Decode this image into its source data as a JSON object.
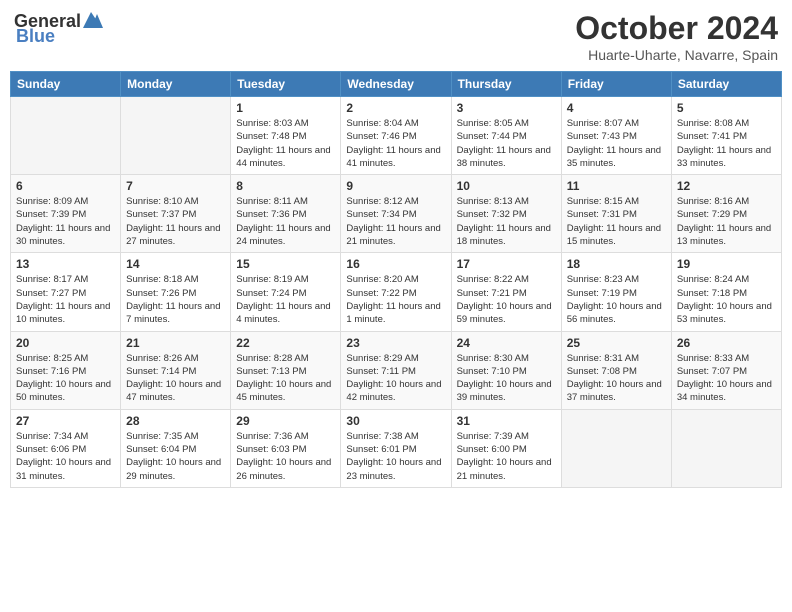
{
  "header": {
    "logo_general": "General",
    "logo_blue": "Blue",
    "title": "October 2024",
    "location": "Huarte-Uharte, Navarre, Spain"
  },
  "weekdays": [
    "Sunday",
    "Monday",
    "Tuesday",
    "Wednesday",
    "Thursday",
    "Friday",
    "Saturday"
  ],
  "weeks": [
    [
      {
        "day": "",
        "sunrise": "",
        "sunset": "",
        "daylight": ""
      },
      {
        "day": "",
        "sunrise": "",
        "sunset": "",
        "daylight": ""
      },
      {
        "day": "1",
        "sunrise": "Sunrise: 8:03 AM",
        "sunset": "Sunset: 7:48 PM",
        "daylight": "Daylight: 11 hours and 44 minutes."
      },
      {
        "day": "2",
        "sunrise": "Sunrise: 8:04 AM",
        "sunset": "Sunset: 7:46 PM",
        "daylight": "Daylight: 11 hours and 41 minutes."
      },
      {
        "day": "3",
        "sunrise": "Sunrise: 8:05 AM",
        "sunset": "Sunset: 7:44 PM",
        "daylight": "Daylight: 11 hours and 38 minutes."
      },
      {
        "day": "4",
        "sunrise": "Sunrise: 8:07 AM",
        "sunset": "Sunset: 7:43 PM",
        "daylight": "Daylight: 11 hours and 35 minutes."
      },
      {
        "day": "5",
        "sunrise": "Sunrise: 8:08 AM",
        "sunset": "Sunset: 7:41 PM",
        "daylight": "Daylight: 11 hours and 33 minutes."
      }
    ],
    [
      {
        "day": "6",
        "sunrise": "Sunrise: 8:09 AM",
        "sunset": "Sunset: 7:39 PM",
        "daylight": "Daylight: 11 hours and 30 minutes."
      },
      {
        "day": "7",
        "sunrise": "Sunrise: 8:10 AM",
        "sunset": "Sunset: 7:37 PM",
        "daylight": "Daylight: 11 hours and 27 minutes."
      },
      {
        "day": "8",
        "sunrise": "Sunrise: 8:11 AM",
        "sunset": "Sunset: 7:36 PM",
        "daylight": "Daylight: 11 hours and 24 minutes."
      },
      {
        "day": "9",
        "sunrise": "Sunrise: 8:12 AM",
        "sunset": "Sunset: 7:34 PM",
        "daylight": "Daylight: 11 hours and 21 minutes."
      },
      {
        "day": "10",
        "sunrise": "Sunrise: 8:13 AM",
        "sunset": "Sunset: 7:32 PM",
        "daylight": "Daylight: 11 hours and 18 minutes."
      },
      {
        "day": "11",
        "sunrise": "Sunrise: 8:15 AM",
        "sunset": "Sunset: 7:31 PM",
        "daylight": "Daylight: 11 hours and 15 minutes."
      },
      {
        "day": "12",
        "sunrise": "Sunrise: 8:16 AM",
        "sunset": "Sunset: 7:29 PM",
        "daylight": "Daylight: 11 hours and 13 minutes."
      }
    ],
    [
      {
        "day": "13",
        "sunrise": "Sunrise: 8:17 AM",
        "sunset": "Sunset: 7:27 PM",
        "daylight": "Daylight: 11 hours and 10 minutes."
      },
      {
        "day": "14",
        "sunrise": "Sunrise: 8:18 AM",
        "sunset": "Sunset: 7:26 PM",
        "daylight": "Daylight: 11 hours and 7 minutes."
      },
      {
        "day": "15",
        "sunrise": "Sunrise: 8:19 AM",
        "sunset": "Sunset: 7:24 PM",
        "daylight": "Daylight: 11 hours and 4 minutes."
      },
      {
        "day": "16",
        "sunrise": "Sunrise: 8:20 AM",
        "sunset": "Sunset: 7:22 PM",
        "daylight": "Daylight: 11 hours and 1 minute."
      },
      {
        "day": "17",
        "sunrise": "Sunrise: 8:22 AM",
        "sunset": "Sunset: 7:21 PM",
        "daylight": "Daylight: 10 hours and 59 minutes."
      },
      {
        "day": "18",
        "sunrise": "Sunrise: 8:23 AM",
        "sunset": "Sunset: 7:19 PM",
        "daylight": "Daylight: 10 hours and 56 minutes."
      },
      {
        "day": "19",
        "sunrise": "Sunrise: 8:24 AM",
        "sunset": "Sunset: 7:18 PM",
        "daylight": "Daylight: 10 hours and 53 minutes."
      }
    ],
    [
      {
        "day": "20",
        "sunrise": "Sunrise: 8:25 AM",
        "sunset": "Sunset: 7:16 PM",
        "daylight": "Daylight: 10 hours and 50 minutes."
      },
      {
        "day": "21",
        "sunrise": "Sunrise: 8:26 AM",
        "sunset": "Sunset: 7:14 PM",
        "daylight": "Daylight: 10 hours and 47 minutes."
      },
      {
        "day": "22",
        "sunrise": "Sunrise: 8:28 AM",
        "sunset": "Sunset: 7:13 PM",
        "daylight": "Daylight: 10 hours and 45 minutes."
      },
      {
        "day": "23",
        "sunrise": "Sunrise: 8:29 AM",
        "sunset": "Sunset: 7:11 PM",
        "daylight": "Daylight: 10 hours and 42 minutes."
      },
      {
        "day": "24",
        "sunrise": "Sunrise: 8:30 AM",
        "sunset": "Sunset: 7:10 PM",
        "daylight": "Daylight: 10 hours and 39 minutes."
      },
      {
        "day": "25",
        "sunrise": "Sunrise: 8:31 AM",
        "sunset": "Sunset: 7:08 PM",
        "daylight": "Daylight: 10 hours and 37 minutes."
      },
      {
        "day": "26",
        "sunrise": "Sunrise: 8:33 AM",
        "sunset": "Sunset: 7:07 PM",
        "daylight": "Daylight: 10 hours and 34 minutes."
      }
    ],
    [
      {
        "day": "27",
        "sunrise": "Sunrise: 7:34 AM",
        "sunset": "Sunset: 6:06 PM",
        "daylight": "Daylight: 10 hours and 31 minutes."
      },
      {
        "day": "28",
        "sunrise": "Sunrise: 7:35 AM",
        "sunset": "Sunset: 6:04 PM",
        "daylight": "Daylight: 10 hours and 29 minutes."
      },
      {
        "day": "29",
        "sunrise": "Sunrise: 7:36 AM",
        "sunset": "Sunset: 6:03 PM",
        "daylight": "Daylight: 10 hours and 26 minutes."
      },
      {
        "day": "30",
        "sunrise": "Sunrise: 7:38 AM",
        "sunset": "Sunset: 6:01 PM",
        "daylight": "Daylight: 10 hours and 23 minutes."
      },
      {
        "day": "31",
        "sunrise": "Sunrise: 7:39 AM",
        "sunset": "Sunset: 6:00 PM",
        "daylight": "Daylight: 10 hours and 21 minutes."
      },
      {
        "day": "",
        "sunrise": "",
        "sunset": "",
        "daylight": ""
      },
      {
        "day": "",
        "sunrise": "",
        "sunset": "",
        "daylight": ""
      }
    ]
  ]
}
